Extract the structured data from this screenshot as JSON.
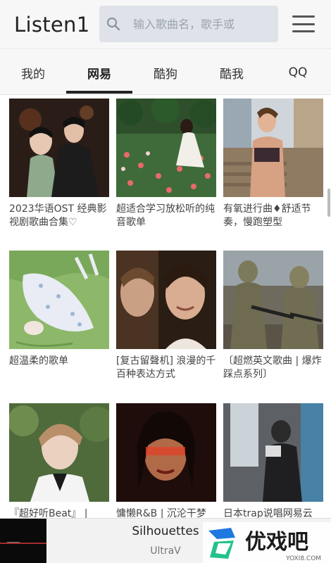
{
  "header": {
    "app_title": "Listen1",
    "search_placeholder": "输入歌曲名，歌手或",
    "menu_icon": "hamburger-menu-icon"
  },
  "tabs": [
    {
      "label": "我的",
      "active": false
    },
    {
      "label": "网易",
      "active": true
    },
    {
      "label": "酷狗",
      "active": false
    },
    {
      "label": "酷我",
      "active": false
    },
    {
      "label": "QQ",
      "active": false
    }
  ],
  "playlists": [
    {
      "title": "2023华语OST 经典影视剧歌曲合集♡"
    },
    {
      "title": "超适合学习放松听的纯音歌单"
    },
    {
      "title": "有氧进行曲♦舒适节奏，慢跑塑型"
    },
    {
      "title": "超温柔的歌单"
    },
    {
      "title": "[复古留聲机] 浪漫的千百种表达方式"
    },
    {
      "title": "〔超燃英文歌曲 | 爆炸踩点系列〕"
    },
    {
      "title": "『超好听Beat』 |"
    },
    {
      "title": "慵懒R&B | 沉沦干梦"
    },
    {
      "title": "日本trap说唱网易云"
    }
  ],
  "player": {
    "song": "Silhouettes",
    "artist": "UltraV"
  },
  "watermark": {
    "brand": "优戏吧",
    "url": "YOXI8.COM"
  }
}
